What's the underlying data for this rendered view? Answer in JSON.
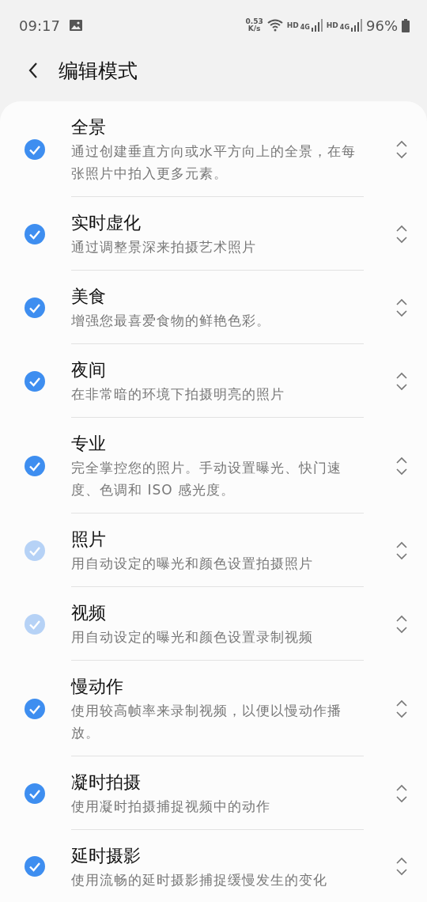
{
  "status_bar": {
    "time": "09:17",
    "speed_value": "0.53",
    "speed_unit": "K/s",
    "sims": [
      {
        "hd": "HD",
        "network": "4G"
      },
      {
        "hd": "HD",
        "network": "4G"
      }
    ],
    "battery": "96%"
  },
  "header": {
    "title": "编辑模式"
  },
  "modes": [
    {
      "title": "全景",
      "description": "通过创建垂直方向或水平方向上的全景，在每张照片中拍入更多元素。",
      "checked": true,
      "disabled": false
    },
    {
      "title": "实时虚化",
      "description": "通过调整景深来拍摄艺术照片",
      "checked": true,
      "disabled": false
    },
    {
      "title": "美食",
      "description": "增强您最喜爱食物的鲜艳色彩。",
      "checked": true,
      "disabled": false
    },
    {
      "title": "夜间",
      "description": "在非常暗的环境下拍摄明亮的照片",
      "checked": true,
      "disabled": false
    },
    {
      "title": "专业",
      "description": "完全掌控您的照片。手动设置曝光、快门速度、色调和 ISO 感光度。",
      "checked": true,
      "disabled": false
    },
    {
      "title": "照片",
      "description": "用自动设定的曝光和颜色设置拍摄照片",
      "checked": true,
      "disabled": true
    },
    {
      "title": "视频",
      "description": "用自动设定的曝光和颜色设置录制视频",
      "checked": true,
      "disabled": true
    },
    {
      "title": "慢动作",
      "description": "使用较高帧率来录制视频，以便以慢动作播放。",
      "checked": true,
      "disabled": false
    },
    {
      "title": "凝时拍摄",
      "description": "使用凝时拍摄捕捉视频中的动作",
      "checked": true,
      "disabled": false
    },
    {
      "title": "延时摄影",
      "description": "使用流畅的延时摄影捕捉缓慢发生的变化",
      "checked": true,
      "disabled": false
    }
  ]
}
